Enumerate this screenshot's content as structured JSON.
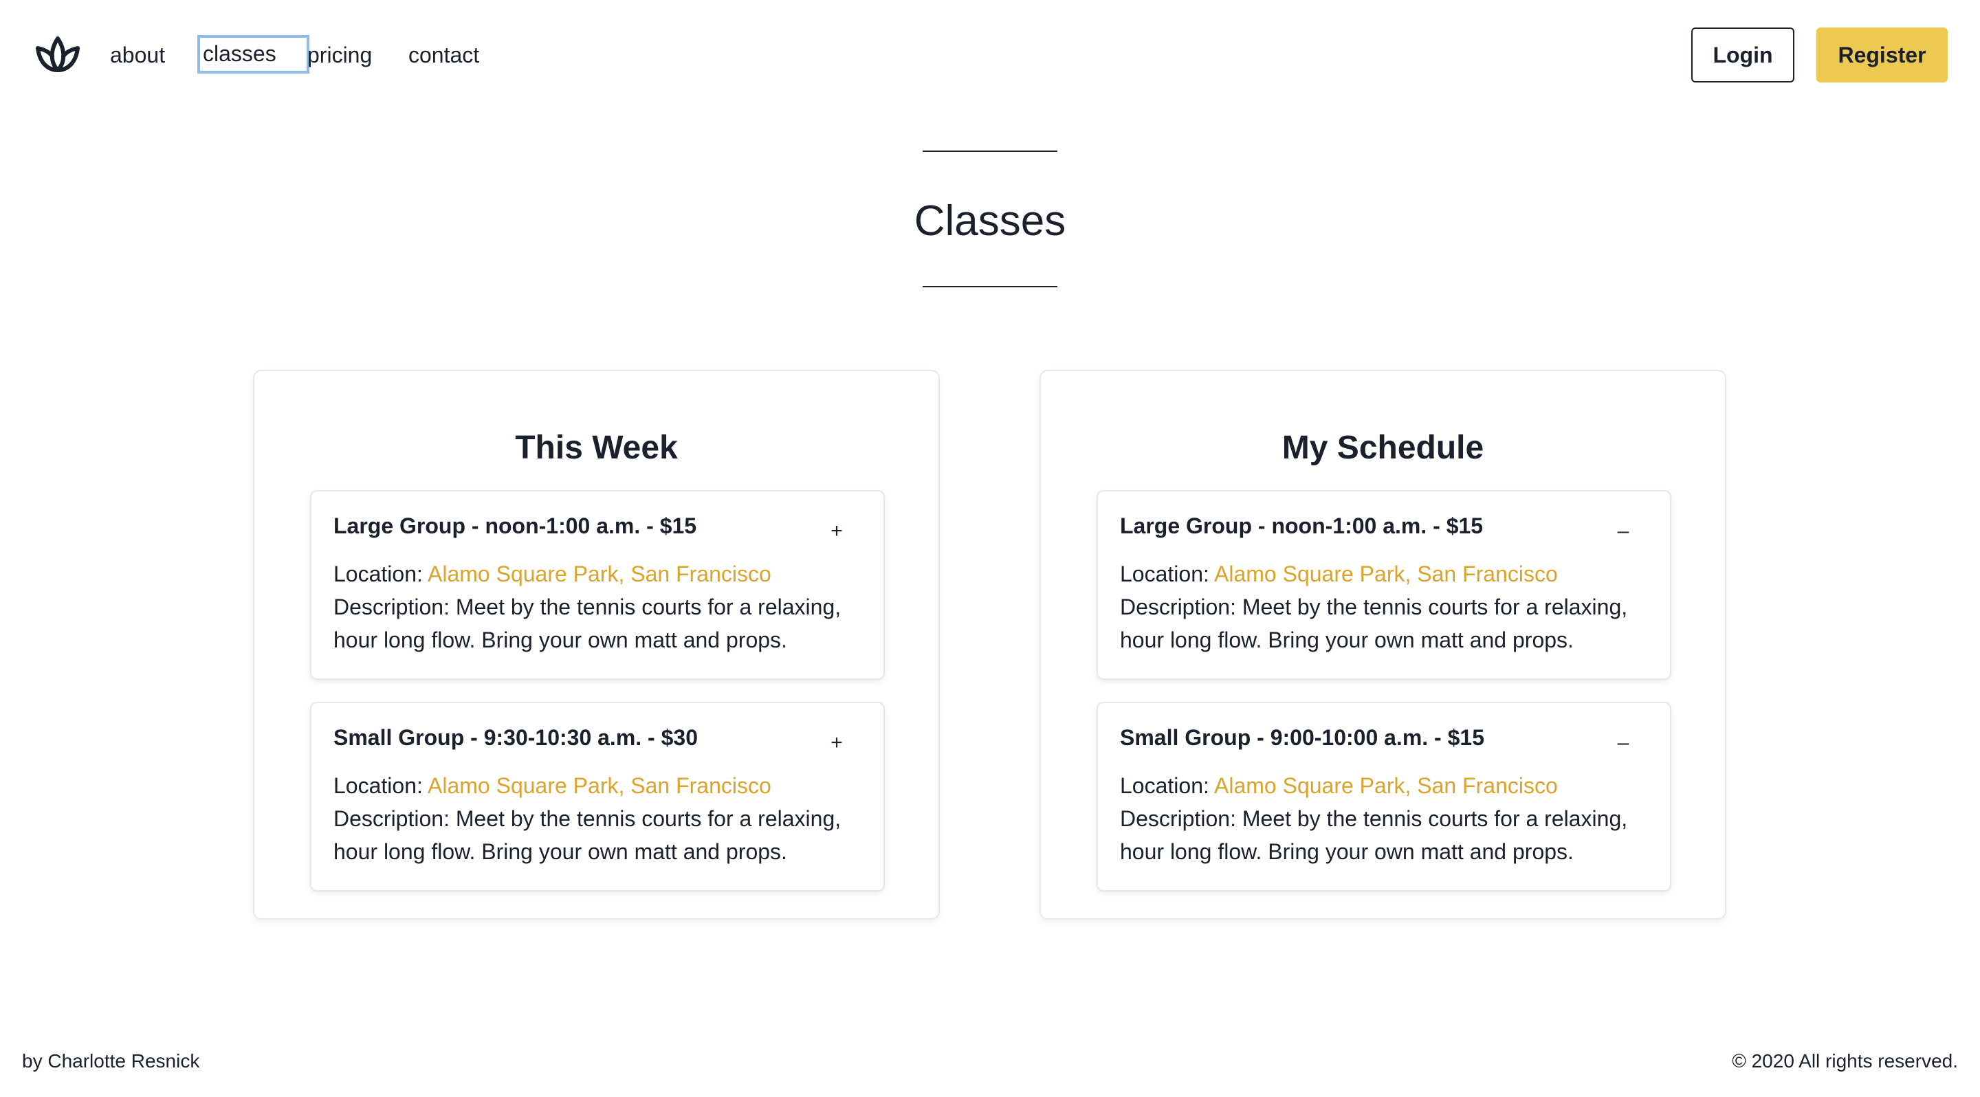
{
  "nav": {
    "logo_icon": "lotus-icon",
    "links": [
      {
        "label": "about"
      },
      {
        "label": "classes"
      },
      {
        "label": "pricing"
      },
      {
        "label": "contact"
      }
    ],
    "login_label": "Login",
    "register_label": "Register"
  },
  "page": {
    "title": "Classes"
  },
  "panels": {
    "this_week": {
      "title": "This Week",
      "classes": [
        {
          "heading": "Large Group - noon-1:00 a.m. - $15",
          "toggle": "+",
          "location_label": "Location:",
          "location": "Alamo Square Park, San Francisco",
          "description": "Description: Meet by the tennis courts for a relaxing, hour long flow. Bring your own matt and props."
        },
        {
          "heading": "Small Group - 9:30-10:30 a.m. - $30",
          "toggle": "+",
          "location_label": "Location:",
          "location": "Alamo Square Park, San Francisco",
          "description": "Description: Meet by the tennis courts for a relaxing, hour long flow. Bring your own matt and props."
        }
      ]
    },
    "my_schedule": {
      "title": "My Schedule",
      "classes": [
        {
          "heading": "Large Group - noon-1:00 a.m. - $15",
          "toggle": "–",
          "location_label": "Location:",
          "location": "Alamo Square Park, San Francisco",
          "description": "Description: Meet by the tennis courts for a relaxing, hour long flow. Bring your own matt and props."
        },
        {
          "heading": "Small Group - 9:00-10:00 a.m. - $15",
          "toggle": "–",
          "location_label": "Location:",
          "location": "Alamo Square Park, San Francisco",
          "description": "Description: Meet by the tennis courts for a relaxing, hour long flow. Bring your own matt and props."
        }
      ]
    }
  },
  "footer": {
    "author": "by Charlotte Resnick",
    "copyright": "© 2020 All rights reserved."
  },
  "colors": {
    "accent": "#edc952",
    "link": "#d9a42c",
    "focus_outline": "#8fbbe6",
    "text": "#1a202c"
  }
}
